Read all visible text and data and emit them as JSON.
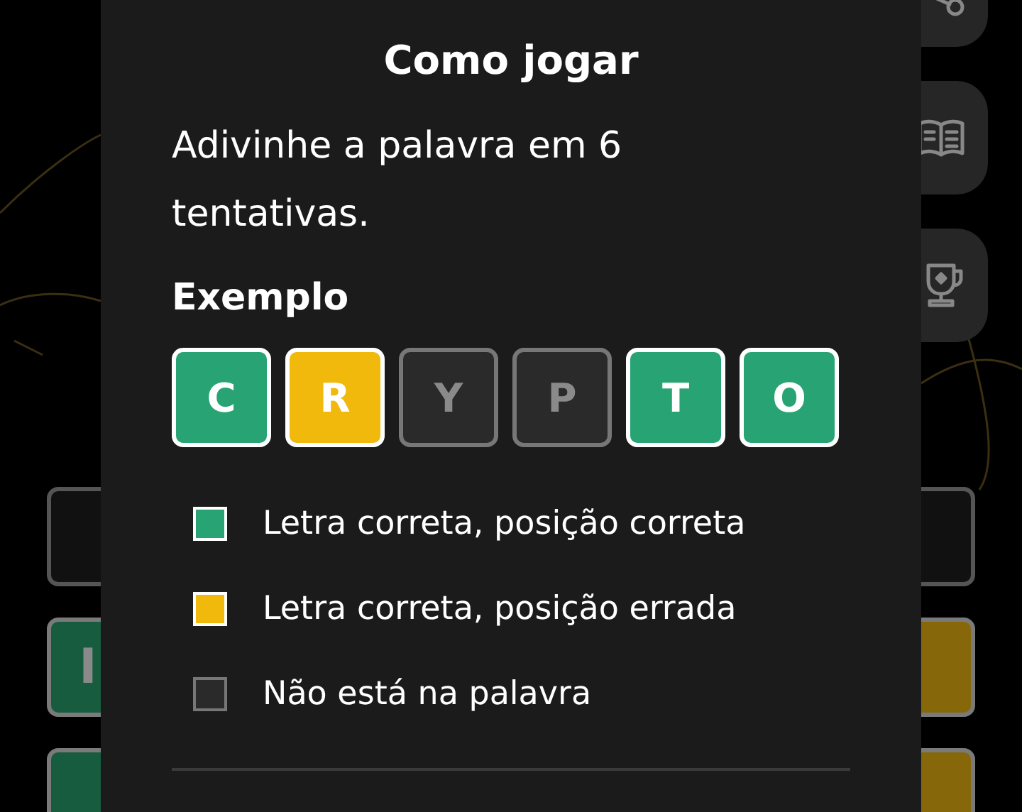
{
  "background_board": {
    "rows": [
      {
        "left": {
          "color": "#111111"
        },
        "right": {
          "color": "#111111"
        }
      },
      {
        "left": {
          "letter": "I",
          "color": "#185c40"
        },
        "right": {
          "color": "#86680a"
        }
      },
      {
        "left": {
          "color": "#185c40"
        },
        "right": {
          "color": "#86680a"
        }
      }
    ]
  },
  "modal": {
    "title": "Como jogar",
    "intro": "Adivinhe a palavra em 6 tentativas.",
    "example_heading": "Exemplo",
    "example_tiles": [
      {
        "letter": "C",
        "color": "#27a374"
      },
      {
        "letter": "R",
        "color": "#f0b90b"
      },
      {
        "letter": "Y",
        "color": "#2a2a2a"
      },
      {
        "letter": "P",
        "color": "#2a2a2a"
      },
      {
        "letter": "T",
        "color": "#27a374"
      },
      {
        "letter": "O",
        "color": "#27a374"
      }
    ],
    "legend": [
      {
        "color": "#27a374",
        "label": "Letra correta, posição correta"
      },
      {
        "color": "#f0b90b",
        "label": "Letra correta, posição errada"
      },
      {
        "color": "#2a2a2a",
        "label": "Não está na palavra"
      }
    ]
  }
}
